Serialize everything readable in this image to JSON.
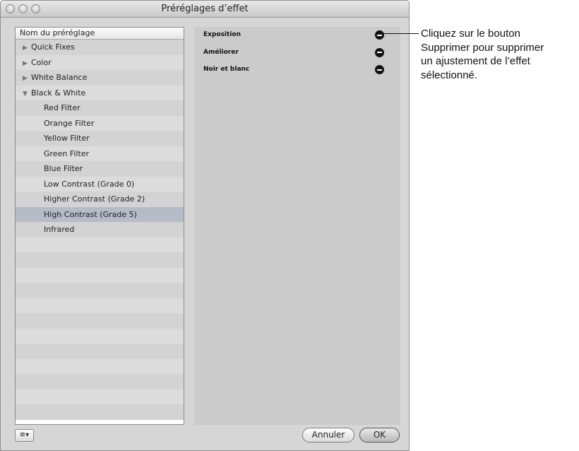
{
  "window": {
    "title": "Préréglages d’effet"
  },
  "list": {
    "header": "Nom du préréglage",
    "rows": [
      {
        "label": "Quick Fixes",
        "kind": "group",
        "expanded": false
      },
      {
        "label": "Color",
        "kind": "group",
        "expanded": false
      },
      {
        "label": "White Balance",
        "kind": "group",
        "expanded": false
      },
      {
        "label": "Black & White",
        "kind": "group",
        "expanded": true
      },
      {
        "label": "Red Filter",
        "kind": "child"
      },
      {
        "label": "Orange Filter",
        "kind": "child"
      },
      {
        "label": "Yellow Filter",
        "kind": "child"
      },
      {
        "label": "Green Filter",
        "kind": "child"
      },
      {
        "label": "Blue Filter",
        "kind": "child"
      },
      {
        "label": "Low Contrast (Grade 0)",
        "kind": "child"
      },
      {
        "label": "Higher Contrast (Grade 2)",
        "kind": "child"
      },
      {
        "label": "High Contrast (Grade 5)",
        "kind": "child",
        "selected": true
      },
      {
        "label": "Infrared",
        "kind": "child"
      }
    ]
  },
  "adjustments": [
    {
      "label": "Exposition"
    },
    {
      "label": "Améliorer"
    },
    {
      "label": "Noir et blanc"
    }
  ],
  "buttons": {
    "cancel": "Annuler",
    "ok": "OK",
    "action_icon": "gear-icon"
  },
  "callout": {
    "lines": [
      "Cliquez sur le bouton",
      "Supprimer pour supprimer",
      "un ajustement de l’effet",
      "sélectionné."
    ]
  },
  "colors": {
    "selection": "#b5bcc8",
    "remove_button": "#111111"
  }
}
